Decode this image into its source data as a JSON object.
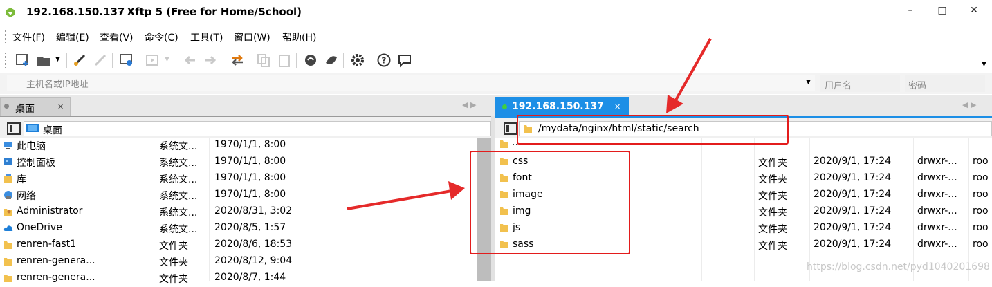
{
  "title": {
    "host": "192.168.150.137",
    "app": "- Xftp 5 (Free for Home/School)"
  },
  "window_controls": {
    "minimize": "–",
    "maximize": "□",
    "close": "✕"
  },
  "menu": [
    "文件(F)",
    "编辑(E)",
    "查看(V)",
    "命令(C)",
    "工具(T)",
    "窗口(W)",
    "帮助(H)"
  ],
  "address": {
    "host_placeholder": "主机名或IP地址",
    "user_placeholder": "用户名",
    "password_placeholder": "密码"
  },
  "left_pane": {
    "tab": "桌面",
    "path": "桌面",
    "rows": [
      {
        "name": "此电脑",
        "type": "系统文...",
        "date": "1970/1/1, 8:00",
        "icon": "computer-icon"
      },
      {
        "name": "控制面板",
        "type": "系统文...",
        "date": "1970/1/1, 8:00",
        "icon": "control-panel-icon"
      },
      {
        "name": "库",
        "type": "系统文...",
        "date": "1970/1/1, 8:00",
        "icon": "library-icon"
      },
      {
        "name": "网络",
        "type": "系统文...",
        "date": "1970/1/1, 8:00",
        "icon": "network-icon"
      },
      {
        "name": "Administrator",
        "type": "系统文...",
        "date": "2020/8/31, 3:02",
        "icon": "user-folder-icon"
      },
      {
        "name": "OneDrive",
        "type": "系统文...",
        "date": "2020/8/5, 1:57",
        "icon": "cloud-icon"
      },
      {
        "name": "renren-fast1",
        "type": "文件夹",
        "date": "2020/8/6, 18:53",
        "icon": "folder-icon"
      },
      {
        "name": "renren-genera...",
        "type": "文件夹",
        "date": "2020/8/12, 9:04",
        "icon": "folder-icon"
      },
      {
        "name": "renren-genera...",
        "type": "文件夹",
        "date": "2020/8/7, 1:44",
        "icon": "folder-icon"
      }
    ]
  },
  "right_pane": {
    "tab": "192.168.150.137",
    "path": "/mydata/nginx/html/static/search",
    "parent": "..",
    "rows": [
      {
        "name": "css",
        "type": "文件夹",
        "date": "2020/9/1, 17:24",
        "perm": "drwxr-...",
        "owner": "roo"
      },
      {
        "name": "font",
        "type": "文件夹",
        "date": "2020/9/1, 17:24",
        "perm": "drwxr-...",
        "owner": "roo"
      },
      {
        "name": "image",
        "type": "文件夹",
        "date": "2020/9/1, 17:24",
        "perm": "drwxr-...",
        "owner": "roo"
      },
      {
        "name": "img",
        "type": "文件夹",
        "date": "2020/9/1, 17:24",
        "perm": "drwxr-...",
        "owner": "roo"
      },
      {
        "name": "js",
        "type": "文件夹",
        "date": "2020/9/1, 17:24",
        "perm": "drwxr-...",
        "owner": "roo"
      },
      {
        "name": "sass",
        "type": "文件夹",
        "date": "2020/9/1, 17:24",
        "perm": "drwxr-...",
        "owner": "roo"
      }
    ]
  },
  "watermark": "https://blog.csdn.net/pyd1040201698",
  "colors": {
    "accent": "#1d8fe6",
    "annotation": "#e31c1c",
    "folder": "#f2c14e"
  }
}
